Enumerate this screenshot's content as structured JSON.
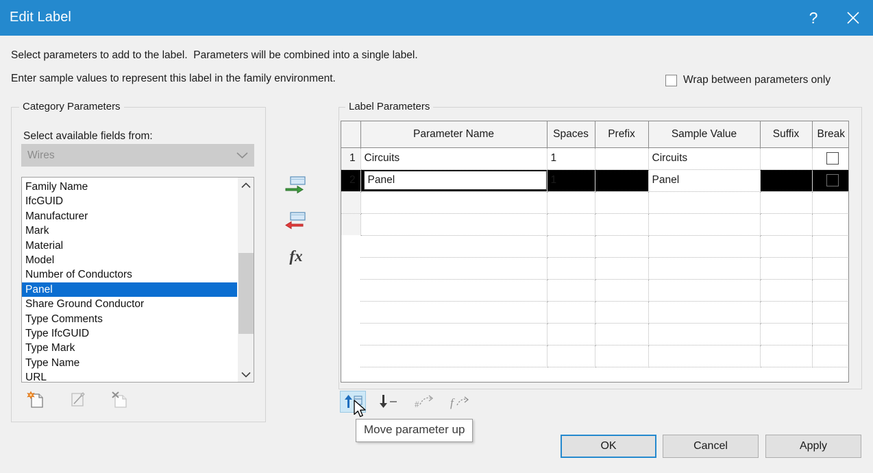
{
  "window": {
    "title": "Edit Label",
    "help_icon": "help-icon",
    "help_glyph": "?",
    "close_icon": "close-icon",
    "accent_color": "#2489ce"
  },
  "intro": {
    "line1": "Select parameters to add to the label.  Parameters will be combined into a single label.",
    "line2": "Enter sample values to represent this label in the family environment."
  },
  "wrap_option": {
    "label": "Wrap between parameters only",
    "checked": false
  },
  "category_panel": {
    "group_title": "Category Parameters",
    "select_from_label": "Select available fields from:",
    "combo": {
      "value": "Wires",
      "disabled": true,
      "arrow_icon": "chevron-down-icon"
    },
    "list": {
      "items": [
        {
          "label": "Family Name",
          "selected": false
        },
        {
          "label": "IfcGUID",
          "selected": false
        },
        {
          "label": "Manufacturer",
          "selected": false
        },
        {
          "label": "Mark",
          "selected": false
        },
        {
          "label": "Material",
          "selected": false
        },
        {
          "label": "Model",
          "selected": false
        },
        {
          "label": "Number of Conductors",
          "selected": false
        },
        {
          "label": "Panel",
          "selected": true
        },
        {
          "label": "Share Ground Conductor",
          "selected": false
        },
        {
          "label": "Type Comments",
          "selected": false
        },
        {
          "label": "Type IfcGUID",
          "selected": false
        },
        {
          "label": "Type Mark",
          "selected": false
        },
        {
          "label": "Type Name",
          "selected": false
        },
        {
          "label": "URL",
          "selected": false
        }
      ],
      "selection_color": "#0b6ed1",
      "scroll_up_icon": "chevron-up-icon",
      "scroll_down_icon": "chevron-down-icon"
    },
    "toolbar": [
      {
        "name": "new-parameter-button",
        "icon": "new-parameter-icon",
        "enabled": true
      },
      {
        "name": "edit-parameter-button",
        "icon": "edit-parameter-icon",
        "enabled": false
      },
      {
        "name": "delete-parameter-button",
        "icon": "delete-parameter-icon",
        "enabled": false
      }
    ]
  },
  "transfer_toolbar": [
    {
      "name": "add-parameter-button",
      "icon": "add-parameter-icon",
      "enabled": true
    },
    {
      "name": "remove-parameter-button",
      "icon": "remove-parameter-icon",
      "enabled": true
    },
    {
      "name": "formula-button",
      "icon": "fx-icon",
      "label": "fx",
      "enabled": true
    }
  ],
  "label_panel": {
    "group_title": "Label Parameters",
    "columns": [
      "",
      "Parameter Name",
      "Spaces",
      "Prefix",
      "Sample Value",
      "Suffix",
      "Break"
    ],
    "rows": [
      {
        "number": "1",
        "parameter_name": "Circuits",
        "spaces": "1",
        "prefix": "",
        "sample_value": "Circuits",
        "suffix": "",
        "break": false,
        "selected": false,
        "editing": false
      },
      {
        "number": "2",
        "parameter_name": "Panel",
        "spaces": "1",
        "prefix": "",
        "sample_value": "Panel",
        "suffix": "",
        "break": false,
        "selected": true,
        "editing": true
      }
    ],
    "toolbar": [
      {
        "name": "move-parameter-up-button",
        "icon": "move-up-icon",
        "enabled": true,
        "hovered": true
      },
      {
        "name": "move-parameter-down-button",
        "icon": "move-down-icon",
        "enabled": true,
        "hovered": false
      },
      {
        "name": "group-parameters-button",
        "icon": "group-parameters-icon",
        "enabled": false,
        "hovered": false
      },
      {
        "name": "ungroup-parameters-button",
        "icon": "ungroup-parameters-icon",
        "enabled": false,
        "hovered": false
      }
    ]
  },
  "tooltip": {
    "text": "Move parameter up"
  },
  "footer": {
    "ok": "OK",
    "cancel": "Cancel",
    "apply": "Apply"
  }
}
